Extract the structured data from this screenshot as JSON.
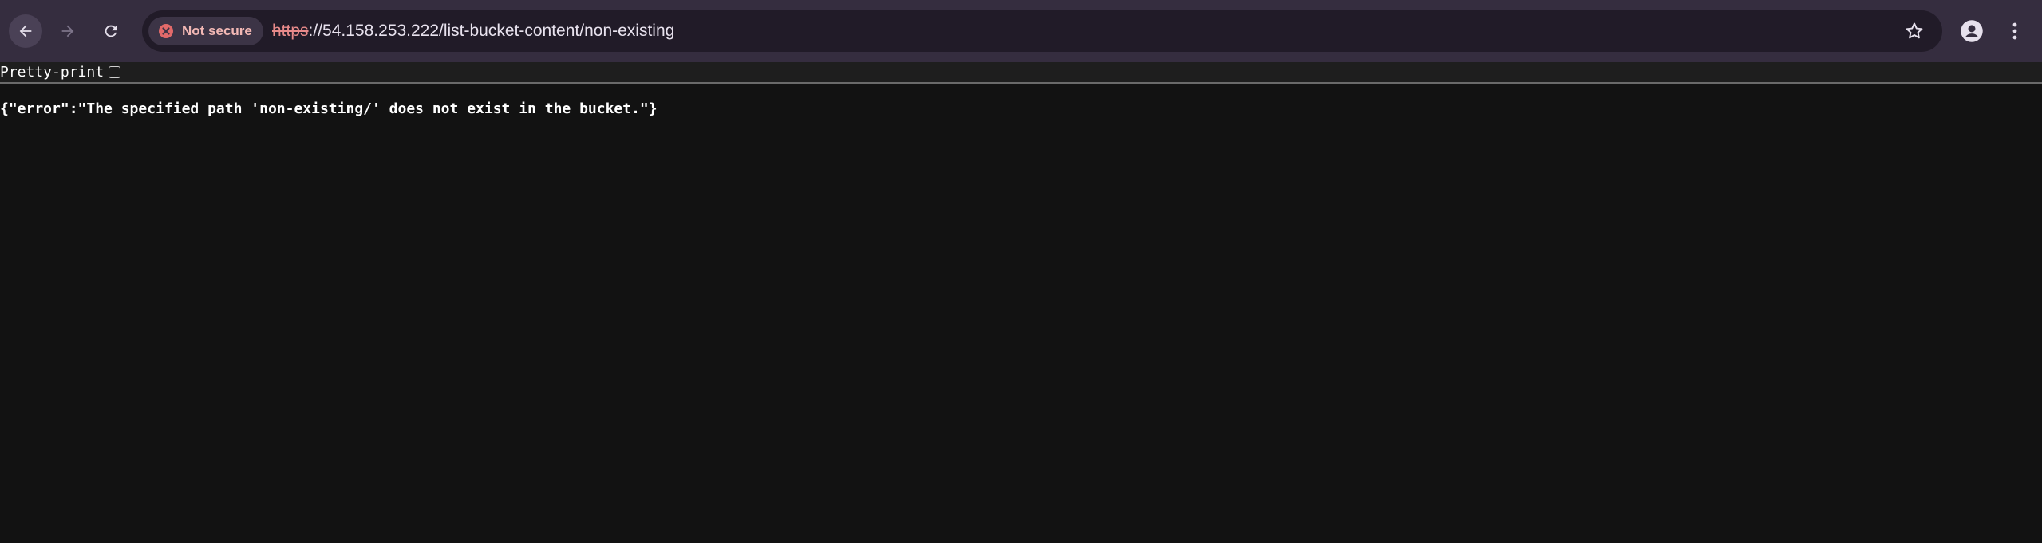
{
  "browser": {
    "security_label": "Not secure",
    "url_scheme": "https",
    "url_rest": "://54.158.253.222/list-bucket-content/non-existing",
    "colors": {
      "toolbar": "#352d3f",
      "omnibox": "#211b28",
      "insecure_text": "#f2b8b5",
      "insecure_icon": "#e26a6a"
    },
    "icons": [
      "back-arrow-icon",
      "forward-arrow-icon",
      "reload-icon",
      "not-secure-icon",
      "star-icon",
      "profile-icon",
      "kebab-menu-icon"
    ]
  },
  "viewer": {
    "pretty_print_label": "Pretty-print",
    "pretty_print_checked": false
  },
  "content": {
    "json_text": "{\"error\":\"The specified path 'non-existing/' does not exist in the bucket.\"}"
  }
}
